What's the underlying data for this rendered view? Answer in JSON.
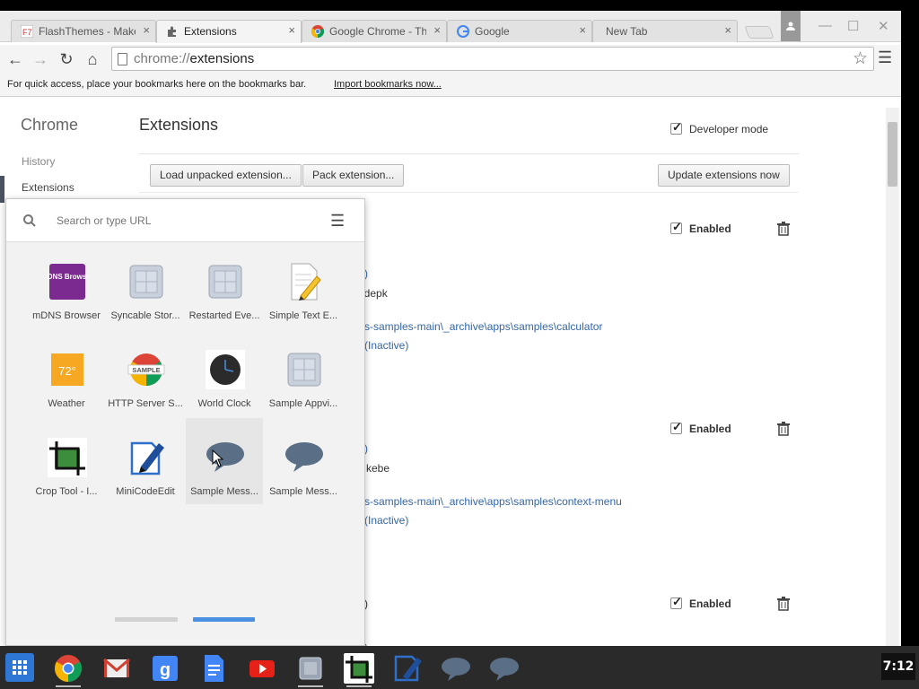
{
  "tabs": [
    {
      "title": "FlashThemes - Make",
      "icon": "flashthemes-favicon-icon",
      "active": false
    },
    {
      "title": "Extensions",
      "icon": "puzzle-icon",
      "active": true
    },
    {
      "title": "Google Chrome - Th",
      "icon": "chrome-favicon-icon",
      "active": false
    },
    {
      "title": "Google",
      "icon": "google-favicon-icon",
      "active": false
    },
    {
      "title": "New Tab",
      "icon": "",
      "active": false
    }
  ],
  "tab_close_glyph": "×",
  "toolbar": {
    "url_scheme": "chrome://",
    "url_path": "extensions"
  },
  "bookmarks_bar": {
    "hint": "For quick access, place your bookmarks here on the bookmarks bar.",
    "import_link": "Import bookmarks now..."
  },
  "sidebar": {
    "title": "Chrome",
    "items": [
      "History",
      "Extensions"
    ]
  },
  "extensions_page": {
    "title": "Extensions",
    "developer_mode_label": "Developer mode",
    "buttons": {
      "load_unpacked": "Load unpacked extension...",
      "pack": "Pack extension...",
      "update": "Update extensions now"
    },
    "entries": [
      {
        "enabled_label": "Enabled",
        "partial_lines": [
          ")",
          "gdepk",
          "s-samples-main\\_archive\\apps\\samples\\calculator",
          "(Inactive)"
        ]
      },
      {
        "enabled_label": "Enabled",
        "partial_lines": [
          ")",
          "kebe",
          "s-samples-main\\_archive\\apps\\samples\\context-menu",
          "(Inactive)"
        ]
      },
      {
        "enabled_label": "Enabled",
        "partial_lines": [
          ")",
          ")"
        ]
      }
    ]
  },
  "launcher": {
    "search_placeholder": "Search or type URL",
    "apps": [
      {
        "label": "mDNS Browser",
        "icon": "mdns-browser-icon",
        "icon_text": "MDNS Browser"
      },
      {
        "label": "Syncable Stor...",
        "icon": "generic-app-icon"
      },
      {
        "label": "Restarted Eve...",
        "icon": "generic-app-icon"
      },
      {
        "label": "Simple Text E...",
        "icon": "text-editor-pencil-icon"
      },
      {
        "label": "Weather",
        "icon": "weather-icon",
        "icon_text": "72°"
      },
      {
        "label": "HTTP Server S...",
        "icon": "sample-badge-icon",
        "icon_text": "SAMPLE"
      },
      {
        "label": "World Clock",
        "icon": "clock-icon"
      },
      {
        "label": "Sample Appvi...",
        "icon": "generic-app-icon"
      },
      {
        "label": "Crop Tool - I...",
        "icon": "crop-icon"
      },
      {
        "label": "MiniCodeEdit",
        "icon": "code-edit-icon"
      },
      {
        "label": "Sample Mess...",
        "icon": "speech-bubble-icon"
      },
      {
        "label": "Sample Mess...",
        "icon": "speech-bubble-icon"
      }
    ],
    "pages": 2,
    "current_page": 2
  },
  "shelf": {
    "apps": [
      "chrome-icon",
      "gmail-icon",
      "google-search-icon",
      "docs-icon",
      "youtube-icon",
      "generic-app-icon",
      "crop-icon",
      "code-edit-icon",
      "speech-bubble-icon",
      "speech-bubble-icon"
    ],
    "clock": "7:12"
  },
  "colors": {
    "link": "#3366aa",
    "accent": "#4a90e2",
    "shelf": "#2a2a2a"
  }
}
